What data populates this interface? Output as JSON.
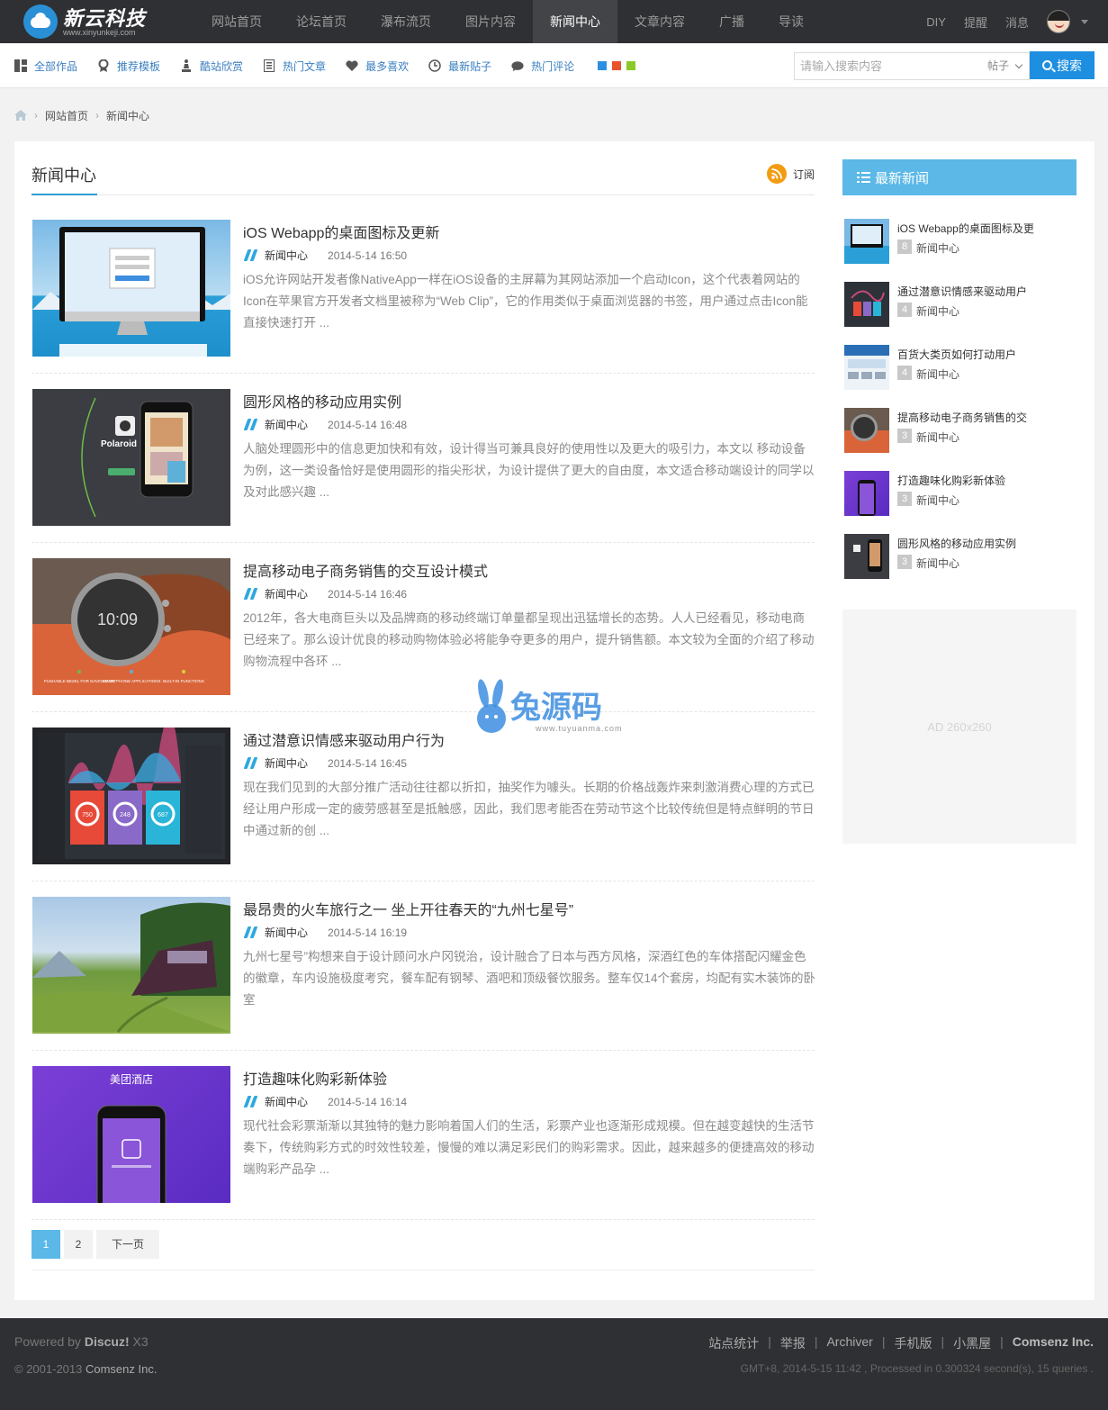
{
  "brand": {
    "name": "新云科技",
    "url": "www.xinyunkeji.com"
  },
  "main_nav": [
    {
      "label": "网站首页",
      "active": false
    },
    {
      "label": "论坛首页",
      "active": false
    },
    {
      "label": "瀑布流页",
      "active": false
    },
    {
      "label": "图片内容",
      "active": false
    },
    {
      "label": "新闻中心",
      "active": true
    },
    {
      "label": "文章内容",
      "active": false
    },
    {
      "label": "广播",
      "active": false
    },
    {
      "label": "导读",
      "active": false
    }
  ],
  "user_nav": {
    "diy": "DIY",
    "remind": "提醒",
    "message": "消息"
  },
  "sub_nav": [
    {
      "label": "全部作品",
      "icon": "grid-icon"
    },
    {
      "label": "推荐模板",
      "icon": "award-icon"
    },
    {
      "label": "酷站欣赏",
      "icon": "trophy-icon"
    },
    {
      "label": "热门文章",
      "icon": "document-icon"
    },
    {
      "label": "最多喜欢",
      "icon": "heart-icon"
    },
    {
      "label": "最新贴子",
      "icon": "clock-icon"
    },
    {
      "label": "热门评论",
      "icon": "comment-icon"
    }
  ],
  "theme_swatches": [
    "#2a8fe0",
    "#e8542a",
    "#8ac926"
  ],
  "search": {
    "placeholder": "请输入搜索内容",
    "type": "帖子",
    "button": "搜索"
  },
  "breadcrumb": {
    "home": "网站首页",
    "current": "新闻中心",
    "sep": "›"
  },
  "main": {
    "title": "新闻中心",
    "subscribe": "订阅",
    "articles": [
      {
        "title": "iOS Webapp的桌面图标及更新",
        "category": "新闻中心",
        "date": "2014-5-14 16:50",
        "summary": "iOS允许网站开发者像NativeApp一样在iOS设备的主屏幕为其网站添加一个启动Icon，这个代表着网站的Icon在苹果官方开发者文档里被称为“Web Clip”，它的作用类似于桌面浏览器的书签，用户通过点击Icon能直接快速打开 ..."
      },
      {
        "title": "圆形风格的移动应用实例",
        "category": "新闻中心",
        "date": "2014-5-14 16:48",
        "summary": "人脑处理圆形中的信息更加快和有效，设计得当可兼具良好的使用性以及更大的吸引力，本文以 移动设备为例，这一类设备恰好是使用圆形的指尖形状，为设计提供了更大的自由度，本文适合移动端设计的同学以及对此感兴趣 ..."
      },
      {
        "title": "提高移动电子商务销售的交互设计模式",
        "category": "新闻中心",
        "date": "2014-5-14 16:46",
        "summary": "2012年，各大电商巨头以及品牌商的移动终端订单量都呈现出迅猛增长的态势。人人已经看见，移动电商已经来了。那么设计优良的移动购物体验必将能争夺更多的用户，提升销售额。本文较为全面的介绍了移动购物流程中各环 ..."
      },
      {
        "title": "通过潜意识情感来驱动用户行为",
        "category": "新闻中心",
        "date": "2014-5-14 16:45",
        "summary": "现在我们见到的大部分推广活动往往都以折扣，抽奖作为噱头。长期的价格战轰炸来刺激消费心理的方式已经让用户形成一定的疲劳感甚至是抵触感，因此，我们思考能否在劳动节这个比较传统但是特点鲜明的节日中通过新的创 ..."
      },
      {
        "title": "最昂贵的火车旅行之一 坐上开往春天的“九州七星号”",
        "category": "新闻中心",
        "date": "2014-5-14 16:19",
        "summary": "九州七星号”构想来自于设计顾问水户冈锐治，设计融合了日本与西方风格，深酒红色的车体搭配闪耀金色的徽章，车内设施极度考究，餐车配有钢琴、酒吧和顶级餐饮服务。整车仅14个套房，均配有实木装饰的卧室"
      },
      {
        "title": "打造趣味化购彩新体验",
        "category": "新闻中心",
        "date": "2014-5-14 16:14",
        "summary": "现代社会彩票渐渐以其独特的魅力影响着国人们的生活，彩票产业也逐渐形成规模。但在越变越快的生活节奏下，传统购彩方式的时效性较差，慢慢的难以满足彩民们的购彩需求。因此，越来越多的便捷高效的移动端购彩产品孕 ..."
      }
    ],
    "thumb_text": {
      "polaroid": "Polaroid",
      "watch_time": "10:09",
      "watch_labels": [
        "PUSHABLE BEZEL\nFOR NAVIGATION",
        "SMARTPHONE\nAPPLICATIONS",
        "BUILT-IN\nFUNCTIONS"
      ],
      "dash_values": [
        "750",
        "248",
        "687"
      ],
      "hotel": "美团酒店"
    },
    "pagination": {
      "pages": [
        "1",
        "2"
      ],
      "current": "1",
      "next": "下一页"
    }
  },
  "sidebar": {
    "title": "最新新闻",
    "items": [
      {
        "title": "iOS Webapp的桌面图标及更",
        "count": "8",
        "category": "新闻中心"
      },
      {
        "title": "通过潜意识情感来驱动用户",
        "count": "4",
        "category": "新闻中心"
      },
      {
        "title": "百货大类页如何打动用户",
        "count": "4",
        "category": "新闻中心"
      },
      {
        "title": "提高移动电子商务销售的交",
        "count": "3",
        "category": "新闻中心"
      },
      {
        "title": "打造趣味化购彩新体验",
        "count": "3",
        "category": "新闻中心"
      },
      {
        "title": "圆形风格的移动应用实例",
        "count": "3",
        "category": "新闻中心"
      }
    ],
    "ad": "AD 260x260"
  },
  "watermark": {
    "text": "兔源码",
    "url": "www.tuyuanma.com"
  },
  "footer": {
    "powered_prefix": "Powered by",
    "powered_name": "Discuz!",
    "powered_ver": "X3",
    "copyright_prefix": "© 2001-2013",
    "copyright_company": "Comsenz Inc.",
    "links": [
      "站点统计",
      "举报",
      "Archiver",
      "手机版",
      "小黑屋"
    ],
    "company": "Comsenz Inc.",
    "stats": "GMT+8, 2014-5-15 11:42 , Processed in 0.300324 second(s), 15 queries ."
  },
  "colors": {
    "accent": "#2e9fd8",
    "topbar": "#2f3033",
    "link": "#3a7fc0",
    "search_button": "#1e8fe0"
  }
}
